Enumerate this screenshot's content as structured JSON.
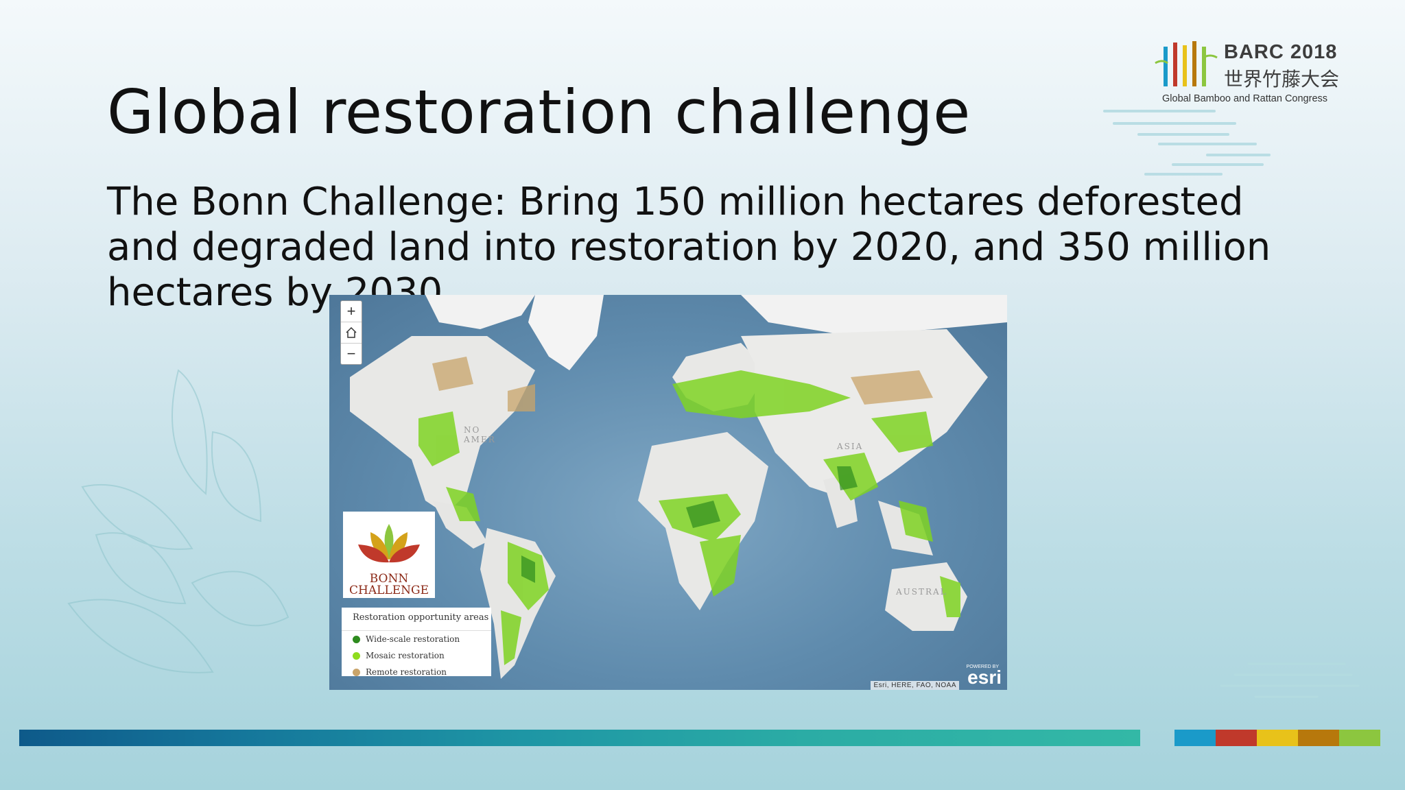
{
  "slide": {
    "title": "Global restoration challenge",
    "body": "The Bonn Challenge: Bring 150 million hectares deforested and degraded land into restoration by 2020, and 350 million hectares by 2030"
  },
  "logo": {
    "brand": "BARC 2018",
    "chinese": "世界竹藤大会",
    "subtitle": "Global Bamboo and Rattan Congress"
  },
  "map": {
    "zoom_in": "+",
    "home": "⌂",
    "zoom_out": "−",
    "labels": {
      "north_america": "NO\nAMER",
      "asia": "ASIA",
      "australia": "AUSTRAL"
    },
    "bonn_logo": {
      "line1": "BONN",
      "line2": "CHALLENGE"
    },
    "legend": {
      "title": "Restoration opportunity areas",
      "items": [
        {
          "label": "Wide-scale restoration",
          "color": "#2e8b1e"
        },
        {
          "label": "Mosaic restoration",
          "color": "#8fdc1e"
        },
        {
          "label": "Remote restoration",
          "color": "#c9a46a"
        }
      ]
    },
    "attribution": "Esri, HERE, FAO, NOAA",
    "powered_by": "POWERED BY",
    "esri": "esri"
  },
  "colors": {
    "bar_swatches": [
      "#1a9ac9",
      "#c0392b",
      "#e8c21a",
      "#b7780c",
      "#8cc63f"
    ]
  }
}
